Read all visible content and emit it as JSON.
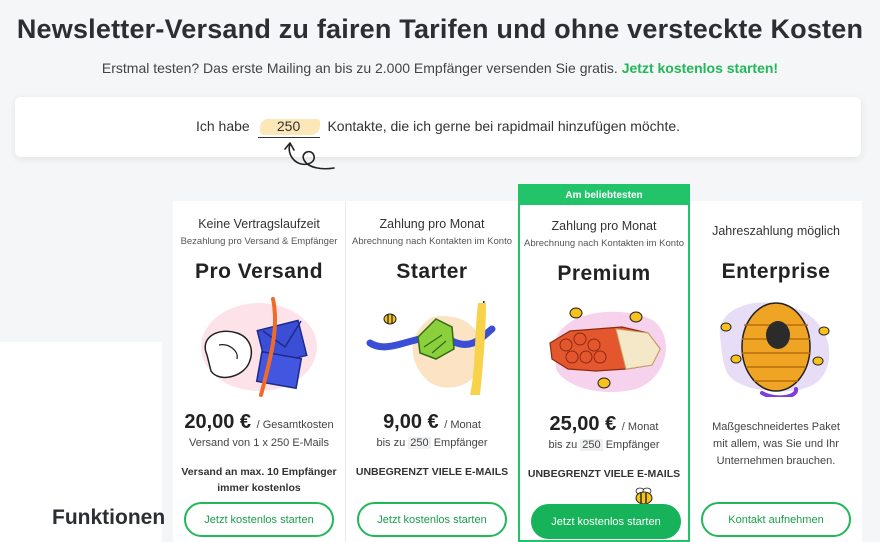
{
  "hero": {
    "title": "Newsletter-Versand zu fairen Tarifen und ohne versteckte Kosten",
    "subtitle": "Erstmal testen? Das erste Mailing an bis zu 2.000 Empfänger versenden Sie gratis.",
    "cta_link": "Jetzt kostenlos starten!"
  },
  "contacts": {
    "prefix": "Ich habe",
    "value": "250",
    "suffix": "Kontakte, die ich gerne bei rapidmail hinzufügen möchte."
  },
  "section": {
    "title": "Funktionen"
  },
  "plans": [
    {
      "top": "Keine Vertragslaufzeit",
      "sub": "Bezahlung pro Versand & Empfänger",
      "name": "Pro Versand",
      "price": "20,00 €",
      "unit": "/ Gesamtkosten",
      "line": "Versand von 1 x 250 E-Mails",
      "extra1": "Versand an max. 10 Empfänger",
      "extra2": "immer kostenlos",
      "button": "Jetzt kostenlos starten"
    },
    {
      "top": "Zahlung pro Monat",
      "sub": "Abrechnung nach Kontakten im Konto",
      "name": "Starter",
      "price": "9,00 €",
      "unit": "/ Monat",
      "line_prefix": "bis zu",
      "line_value": "250",
      "line_suffix": "Empfänger",
      "extra1": "UNBEGRENZT VIELE E-MAILS",
      "button": "Jetzt kostenlos starten"
    },
    {
      "badge": "Am beliebtesten",
      "top": "Zahlung pro Monat",
      "sub": "Abrechnung nach Kontakten im Konto",
      "name": "Premium",
      "price": "25,00 €",
      "unit": "/ Monat",
      "line_prefix": "bis zu",
      "line_value": "250",
      "line_suffix": "Empfänger",
      "extra1": "UNBEGRENZT VIELE E-MAILS",
      "button": "Jetzt kostenlos starten"
    },
    {
      "top": "Jahreszahlung möglich",
      "name": "Enterprise",
      "desc": "Maßgeschneidertes Paket mit allem, was Sie und Ihr Unternehmen brauchen.",
      "button": "Kontakt aufnehmen"
    }
  ],
  "colors": {
    "accent": "#22b85a",
    "badge": "#22c46a",
    "highlight": "#fbe7b8"
  },
  "icons": [
    "envelope-illustration",
    "rocket-leaf-illustration",
    "honeycomb-illustration",
    "beehive-illustration",
    "bee-icon",
    "swirl-arrow-icon"
  ]
}
